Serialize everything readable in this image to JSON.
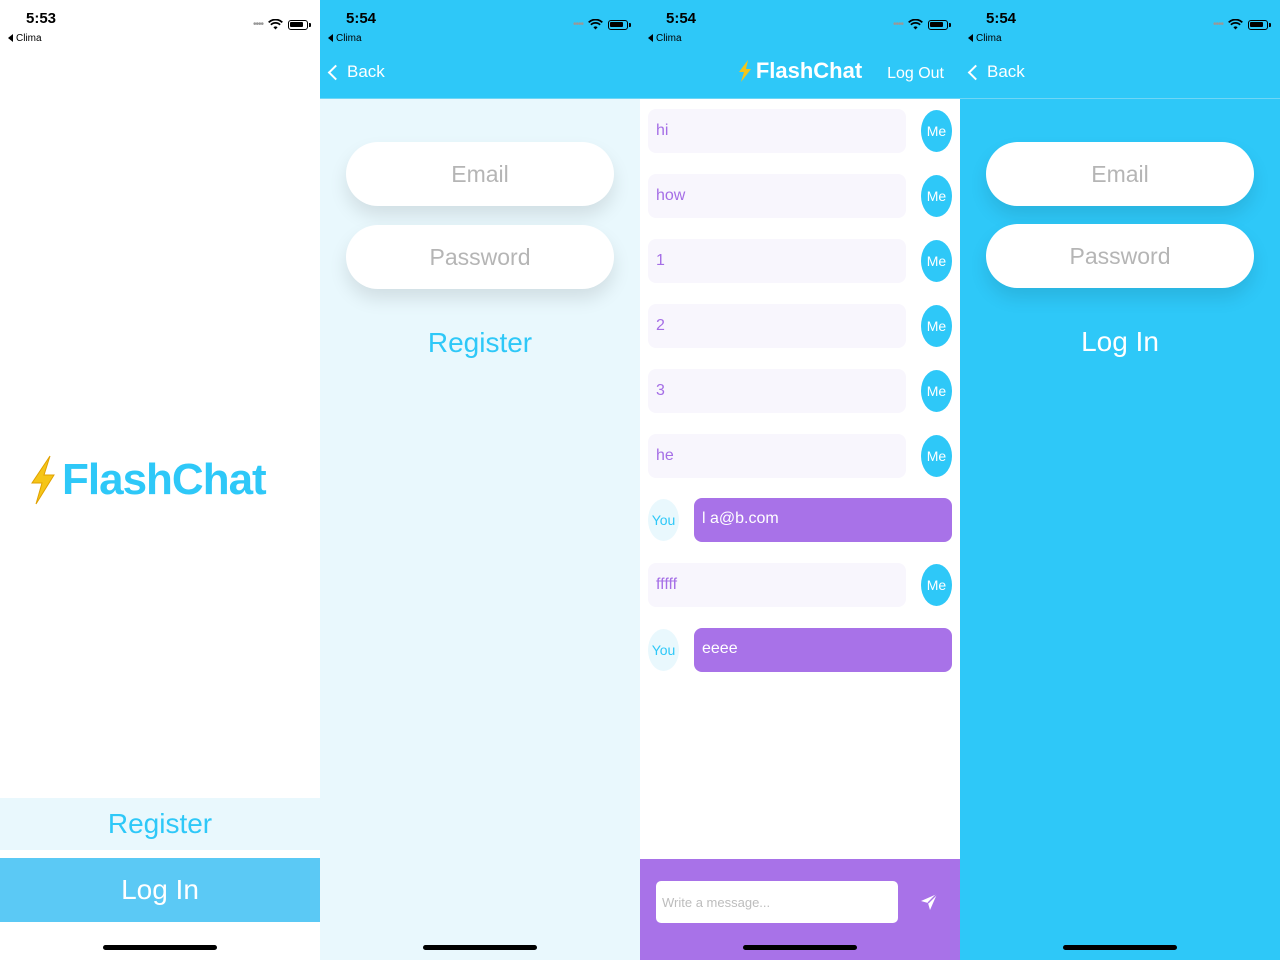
{
  "screen1": {
    "time": "5:53",
    "back_app": "Clima",
    "logo_text": "FlashChat",
    "register_label": "Register",
    "login_label": "Log In"
  },
  "screen2": {
    "time": "5:54",
    "back_app": "Clima",
    "back_label": "Back",
    "email_placeholder": "Email",
    "password_placeholder": "Password",
    "register_label": "Register"
  },
  "screen3": {
    "time": "5:54",
    "back_app": "Clima",
    "title": "FlashChat",
    "logout_label": "Log Out",
    "messages": [
      {
        "sender": "Me",
        "text": "hi"
      },
      {
        "sender": "Me",
        "text": "how"
      },
      {
        "sender": "Me",
        "text": "1"
      },
      {
        "sender": "Me",
        "text": "2"
      },
      {
        "sender": "Me",
        "text": "3"
      },
      {
        "sender": "Me",
        "text": "he"
      },
      {
        "sender": "You",
        "text": "l a@b.com"
      },
      {
        "sender": "Me",
        "text": "fffff"
      },
      {
        "sender": "You",
        "text": "eeee"
      }
    ],
    "message_placeholder": "Write a message..."
  },
  "screen4": {
    "time": "5:54",
    "back_app": "Clima",
    "back_label": "Back",
    "email_placeholder": "Email",
    "password_placeholder": "Password",
    "login_label": "Log In"
  },
  "colors": {
    "brand_blue": "#2ec8f8",
    "light_blue": "#e9f8fd",
    "login_blue": "#5bc9f5",
    "purple": "#a872e8",
    "bolt_yellow": "#f5c518"
  },
  "icons": [
    "lightning-bolt-icon",
    "wifi-icon",
    "battery-icon",
    "back-chevron-icon",
    "send-icon",
    "signal-dots-icon"
  ]
}
